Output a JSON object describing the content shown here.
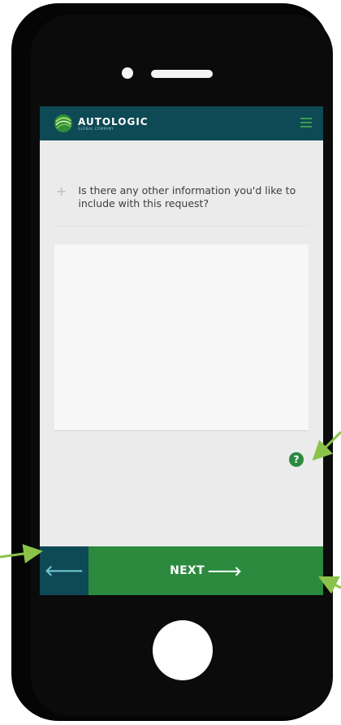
{
  "header": {
    "brand": "AUTOLOGIC",
    "brand_sub": "GLOBAL COMPANY",
    "menu_icon": "hamburger-menu-icon"
  },
  "question": {
    "text": "Is there any other information you'd like to include with this request?",
    "icon": "plus-icon",
    "plus_glyph": "+"
  },
  "answer": {
    "value": "",
    "placeholder": ""
  },
  "help": {
    "icon": "help-icon",
    "glyph": "?"
  },
  "footer": {
    "back_icon": "arrow-left-icon",
    "back_glyph": "🡐",
    "next_label": "NEXT",
    "next_arrow": "🡒"
  },
  "colors": {
    "header_bg": "#0e4a55",
    "accent_green": "#2b8a3e",
    "screen_bg": "#ebebeb",
    "callout_arrow": "#8bc34a"
  }
}
